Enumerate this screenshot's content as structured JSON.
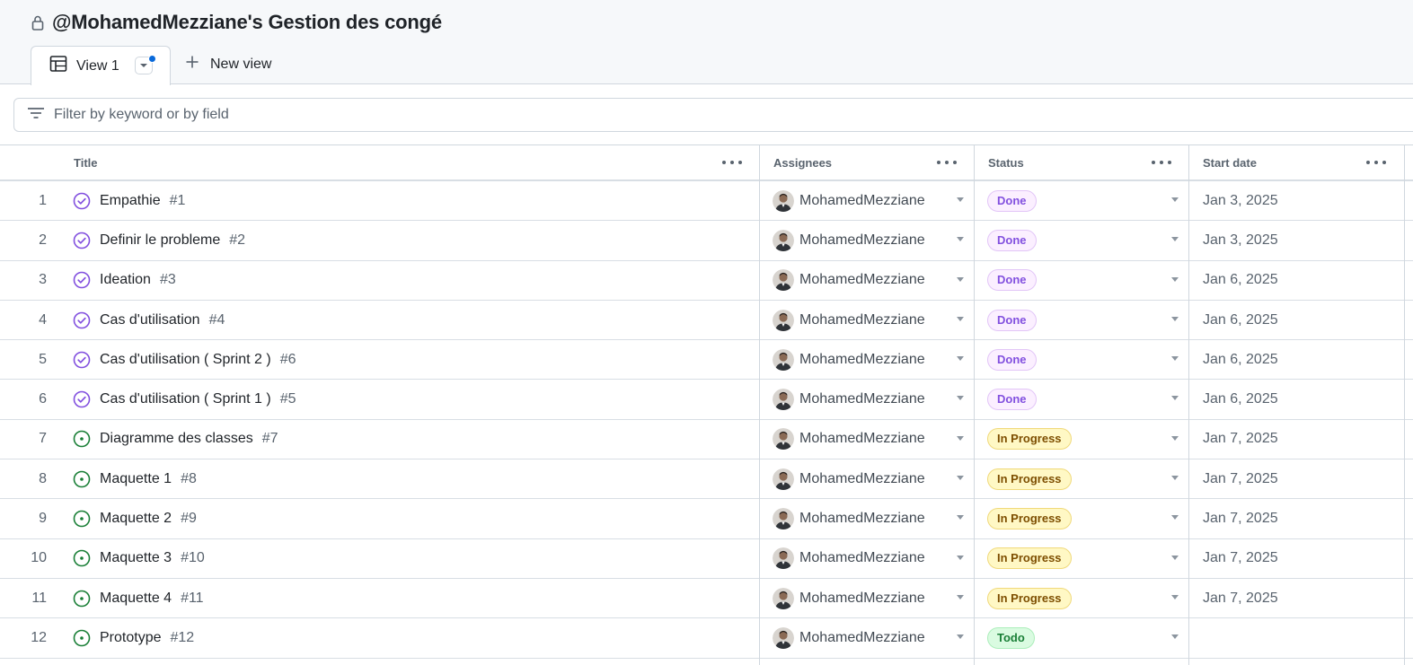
{
  "project": {
    "title": "@MohamedMezziane's Gestion des congé",
    "lock_icon": "lock-icon"
  },
  "tabs": {
    "active_label": "View 1",
    "new_view_label": "New view"
  },
  "filter": {
    "placeholder": "Filter by keyword or by field"
  },
  "columns": {
    "title": "Title",
    "assignees": "Assignees",
    "status": "Status",
    "start_date": "Start date"
  },
  "colors": {
    "done": "#8250df",
    "in_progress": "#7d4e00",
    "todo": "#1a7f37",
    "open_icon": "#1a7f37",
    "closed_icon": "#8250df"
  },
  "rows": [
    {
      "index": "1",
      "title": "Empathie",
      "number": "#1",
      "state": "closed",
      "assignee": "MohamedMezziane",
      "status": "Done",
      "status_kind": "done",
      "start_date": "Jan 3, 2025"
    },
    {
      "index": "2",
      "title": "Definir le probleme",
      "number": "#2",
      "state": "closed",
      "assignee": "MohamedMezziane",
      "status": "Done",
      "status_kind": "done",
      "start_date": "Jan 3, 2025"
    },
    {
      "index": "3",
      "title": "Ideation",
      "number": "#3",
      "state": "closed",
      "assignee": "MohamedMezziane",
      "status": "Done",
      "status_kind": "done",
      "start_date": "Jan 6, 2025"
    },
    {
      "index": "4",
      "title": "Cas d'utilisation",
      "number": "#4",
      "state": "closed",
      "assignee": "MohamedMezziane",
      "status": "Done",
      "status_kind": "done",
      "start_date": "Jan 6, 2025"
    },
    {
      "index": "5",
      "title": "Cas d'utilisation ( Sprint 2 )",
      "number": "#6",
      "state": "closed",
      "assignee": "MohamedMezziane",
      "status": "Done",
      "status_kind": "done",
      "start_date": "Jan 6, 2025"
    },
    {
      "index": "6",
      "title": "Cas d'utilisation ( Sprint 1 )",
      "number": "#5",
      "state": "closed",
      "assignee": "MohamedMezziane",
      "status": "Done",
      "status_kind": "done",
      "start_date": "Jan 6, 2025"
    },
    {
      "index": "7",
      "title": "Diagramme des classes",
      "number": "#7",
      "state": "open",
      "assignee": "MohamedMezziane",
      "status": "In Progress",
      "status_kind": "progress",
      "start_date": "Jan 7, 2025"
    },
    {
      "index": "8",
      "title": "Maquette 1",
      "number": "#8",
      "state": "open",
      "assignee": "MohamedMezziane",
      "status": "In Progress",
      "status_kind": "progress",
      "start_date": "Jan 7, 2025"
    },
    {
      "index": "9",
      "title": "Maquette 2",
      "number": "#9",
      "state": "open",
      "assignee": "MohamedMezziane",
      "status": "In Progress",
      "status_kind": "progress",
      "start_date": "Jan 7, 2025"
    },
    {
      "index": "10",
      "title": "Maquette 3",
      "number": "#10",
      "state": "open",
      "assignee": "MohamedMezziane",
      "status": "In Progress",
      "status_kind": "progress",
      "start_date": "Jan 7, 2025"
    },
    {
      "index": "11",
      "title": "Maquette 4",
      "number": "#11",
      "state": "open",
      "assignee": "MohamedMezziane",
      "status": "In Progress",
      "status_kind": "progress",
      "start_date": "Jan 7, 2025"
    },
    {
      "index": "12",
      "title": "Prototype",
      "number": "#12",
      "state": "open",
      "assignee": "MohamedMezziane",
      "status": "Todo",
      "status_kind": "todo",
      "start_date": ""
    }
  ]
}
